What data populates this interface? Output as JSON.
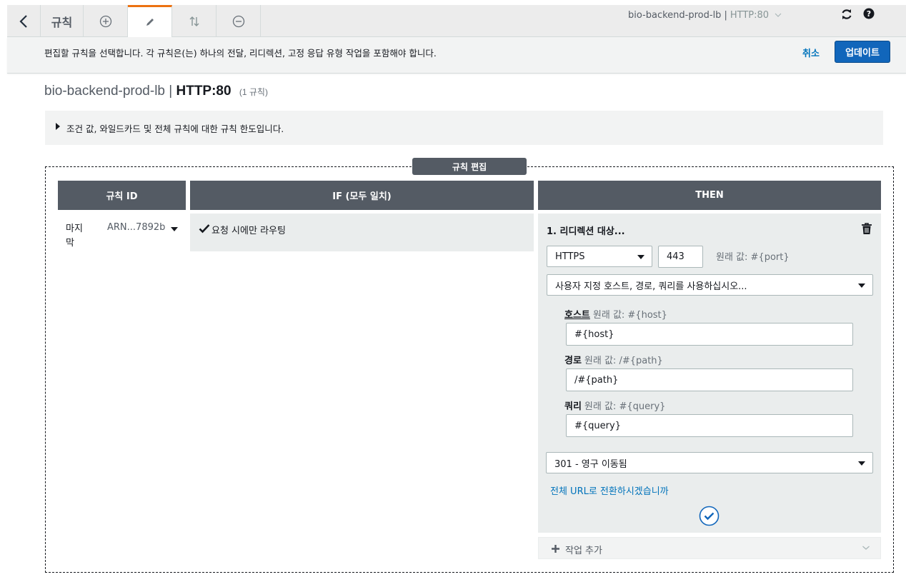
{
  "toolbar": {
    "back_icon": "chevron-left-icon",
    "rules_tab_label": "규칙",
    "icons": [
      "plus-circle-icon",
      "pencil-icon",
      "sort-arrows-icon",
      "minus-circle-icon"
    ],
    "active_icon": "pencil-icon",
    "load_balancer": "bio-backend-prod-lb",
    "separator": "|",
    "listener": "HTTP:80",
    "refresh_icon": "refresh-icon",
    "help_icon": "help-icon"
  },
  "infobar": {
    "message": "편집할 규칙을 선택합니다. 각 규칙은(는) 하나의 전달, 리디렉션, 고정 응답 유형 작업을 포함해야 합니다.",
    "cancel_label": "취소",
    "update_label": "업데이트"
  },
  "heading": {
    "lb_name": "bio-backend-prod-lb",
    "separator": "|",
    "listener": "HTTP:80",
    "rule_count": "(1 규칙)"
  },
  "note": {
    "text": "조건 값, 와일드카드 및 전체 규칙에 대한 규칙 한도입니다."
  },
  "edit_box": {
    "label": "규칙 편집",
    "columns": {
      "rule_id": "규칙 ID",
      "if": "IF (모두 일치)",
      "then": "THEN"
    }
  },
  "rule": {
    "position": "마지막",
    "arn": "ARN...7892b",
    "if_condition": "요청 시에만 라우팅"
  },
  "then": {
    "action_title": "1. 리디렉션 대상...",
    "protocol": "HTTPS",
    "port": "443",
    "port_hint": "원래 값: #{port}",
    "mode": "사용자 지정 호스트, 경로, 쿼리를 사용하십시오...",
    "host": {
      "label": "호스트",
      "hint": "원래 값: #{host}",
      "value": "#{host}"
    },
    "path": {
      "label": "경로",
      "hint": "원래 값: /#{path}",
      "value": "/#{path}"
    },
    "query": {
      "label": "쿼리",
      "hint": "원래 값: #{query}",
      "value": "#{query}"
    },
    "status_code": "301 - 영구 이동됨",
    "switch_link": "전체 URL로 전환하시겠습니까",
    "confirm_icon": "check-circle-icon"
  },
  "add_action": {
    "label": "작업 추가"
  },
  "colors": {
    "header_bg": "#545b64",
    "accent_orange": "#ec7211",
    "primary_blue": "#1166bb",
    "link_blue": "#0073bb"
  }
}
